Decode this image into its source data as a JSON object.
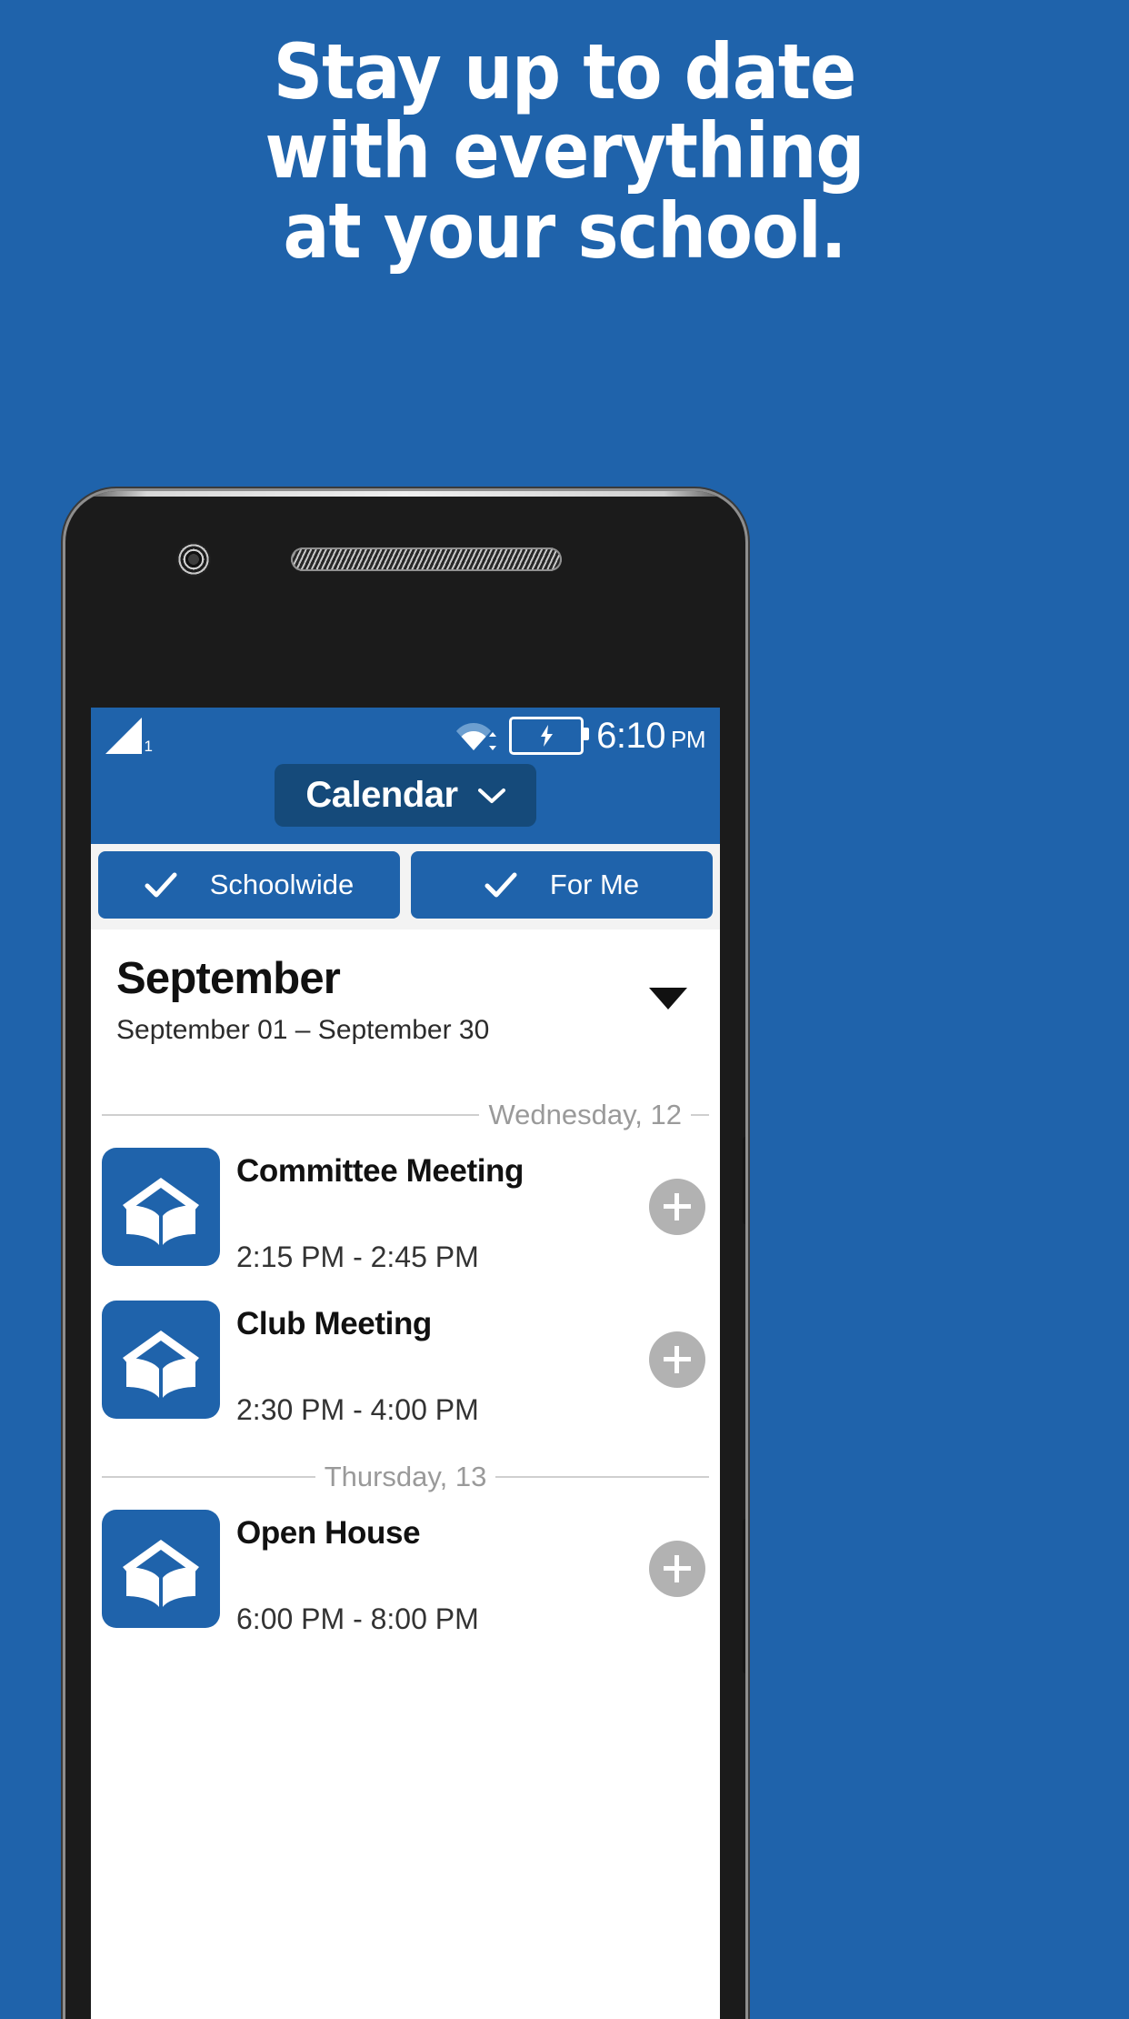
{
  "promo": {
    "headline_lines": [
      "Stay up to date",
      "with everything",
      "at your school."
    ],
    "background_color": "#1f63ab"
  },
  "phone": {
    "status_bar": {
      "signal_label": "1",
      "wifi_icon": "wifi-icon",
      "battery_icon": "battery-charging-icon",
      "time": "6:10",
      "am_pm": "PM"
    },
    "title_bar": {
      "title": "Calendar",
      "dropdown_icon": "chevron-down-icon"
    },
    "filters": [
      {
        "label": "Schoolwide",
        "checked": true,
        "icon": "check-icon"
      },
      {
        "label": "For Me",
        "checked": true,
        "icon": "check-icon"
      }
    ],
    "month_header": {
      "title": "September",
      "range": "September 01 – September 30",
      "expand_icon": "caret-down-icon"
    },
    "agenda": [
      {
        "day_label": "Wednesday, 12",
        "events": [
          {
            "title": "Committee Meeting",
            "time": "2:15 PM - 2:45 PM",
            "icon": "school-book-icon",
            "add_icon": "plus-icon"
          },
          {
            "title": "Club Meeting",
            "time": "2:30 PM - 4:00 PM",
            "icon": "school-book-icon",
            "add_icon": "plus-icon"
          }
        ]
      },
      {
        "day_label": "Thursday, 13",
        "events": [
          {
            "title": "Open House",
            "time": "6:00 PM - 8:00 PM",
            "icon": "school-book-icon",
            "add_icon": "plus-icon"
          }
        ]
      }
    ],
    "colors": {
      "accent": "#1f63ab",
      "accent_dark": "#154a7a",
      "chip_bg": "#f3f3f3",
      "add_button": "#b2b2b2",
      "divider": "#cfcfcf",
      "muted_text": "#9a9a9a"
    }
  }
}
